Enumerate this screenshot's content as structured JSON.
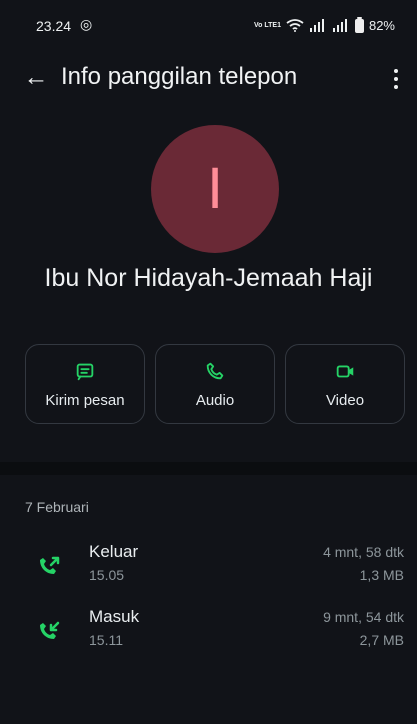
{
  "status_bar": {
    "time": "23.24",
    "battery": "82%",
    "network_text": "Vo LTE1"
  },
  "header": {
    "title": "Info panggilan telepon"
  },
  "contact": {
    "avatar_initial": "I",
    "name": "Ibu Nor Hidayah-Jemaah Haji",
    "avatar_color": "#6a2936",
    "avatar_text_color": "#ff8d98"
  },
  "actions": [
    {
      "label": "Kirim pesan",
      "icon": "message-icon"
    },
    {
      "label": "Audio",
      "icon": "phone-icon"
    },
    {
      "label": "Video",
      "icon": "video-icon"
    }
  ],
  "call_history": {
    "date": "7 Februari",
    "items": [
      {
        "type": "Keluar",
        "time": "15.05",
        "duration": "4 mnt, 58 dtk",
        "size": "1,3 MB",
        "direction_icon": "outgoing-call-icon"
      },
      {
        "type": "Masuk",
        "time": "15.11",
        "duration": "9 mnt, 54 dtk",
        "size": "2,7 MB",
        "direction_icon": "incoming-call-icon"
      }
    ]
  },
  "colors": {
    "accent": "#25d366",
    "background": "#111318",
    "text": "#e9edef",
    "muted": "#8d969b"
  }
}
